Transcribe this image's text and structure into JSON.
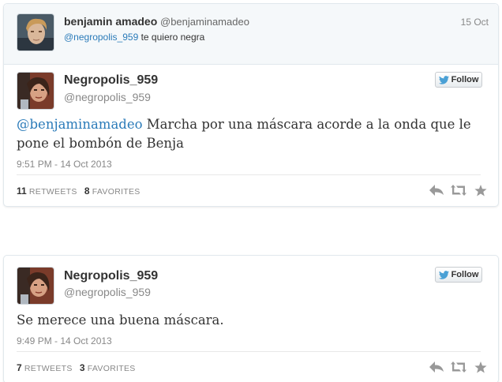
{
  "parent_tweet": {
    "name": "benjamin amadeo",
    "handle": "@benjaminamadeo",
    "date": "15 Oct",
    "mention": "@negropolis_959",
    "text": " te quiero negra"
  },
  "tweets": [
    {
      "name": "Negropolis_959",
      "handle": "@negropolis_959",
      "follow_label": "Follow",
      "mention": "@benjaminamadeo",
      "text": " Marcha por una máscara acorde a la onda que le pone el bombón de Benja",
      "timestamp": "9:51 PM - 14 Oct 2013",
      "retweets_count": "11",
      "retweets_label": "RETWEETS",
      "favorites_count": "8",
      "favorites_label": "FAVORITES"
    },
    {
      "name": "Negropolis_959",
      "handle": "@negropolis_959",
      "follow_label": "Follow",
      "text": "Se merece una buena máscara.",
      "timestamp": "9:49 PM - 14 Oct 2013",
      "retweets_count": "7",
      "retweets_label": "RETWEETS",
      "favorites_count": "3",
      "favorites_label": "FAVORITES"
    }
  ],
  "icons": {
    "bird": "twitter-bird-icon",
    "reply": "reply-icon",
    "retweet": "retweet-icon",
    "favorite": "star-icon"
  },
  "colors": {
    "link": "#2b7bb9",
    "bird": "#4aa0d5",
    "action_icon": "#999999",
    "parent_bg": "#f5f8fa"
  }
}
